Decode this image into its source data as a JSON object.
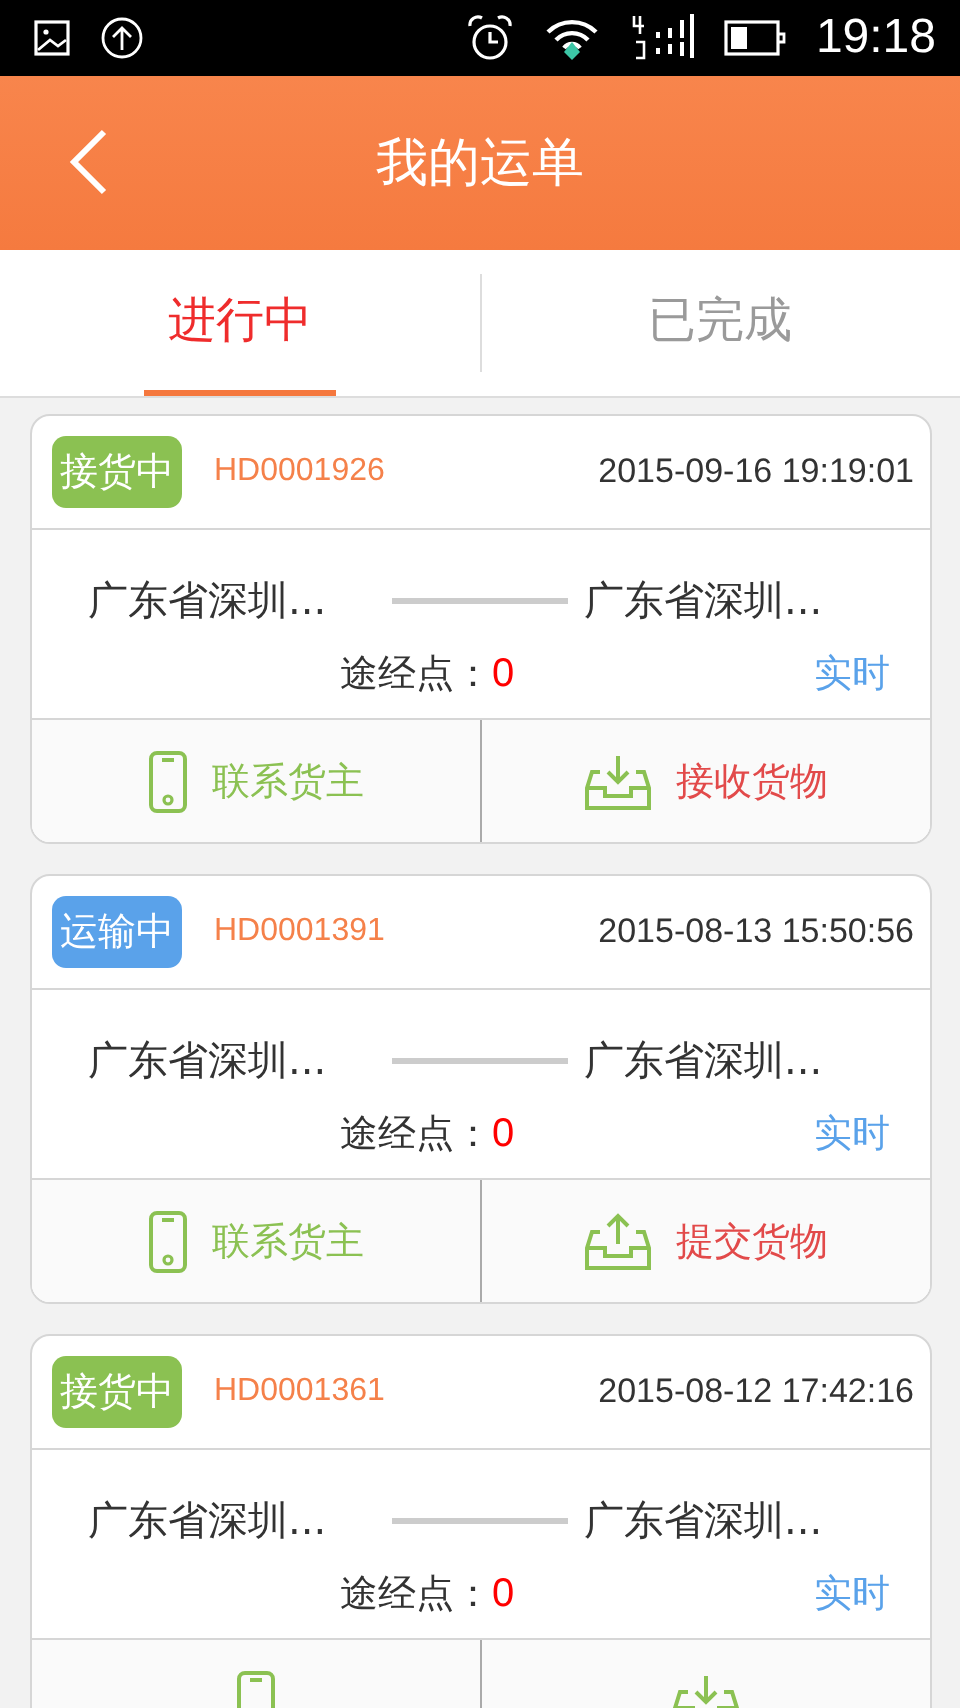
{
  "status_bar": {
    "time": "19:18"
  },
  "header": {
    "title": "我的运单"
  },
  "tabs": [
    {
      "label": "进行中",
      "selected": true
    },
    {
      "label": "已完成",
      "selected": false
    }
  ],
  "orders": [
    {
      "status": {
        "label": "接货中",
        "color": "#8bc152"
      },
      "order_no": "HD0001926",
      "datetime": "2015-09-16 19:19:01",
      "origin": "广东省深圳...",
      "destination": "广东省深圳...",
      "waypoints_label": "途经点：",
      "waypoints_count": "0",
      "realtime_link": "实时",
      "actions": [
        {
          "kind": "phone",
          "label": "联系货主"
        },
        {
          "kind": "receive",
          "label": "接收货物"
        }
      ]
    },
    {
      "status": {
        "label": "运输中",
        "color": "#5aa2ea"
      },
      "order_no": "HD0001391",
      "datetime": "2015-08-13 15:50:56",
      "origin": "广东省深圳...",
      "destination": "广东省深圳...",
      "waypoints_label": "途经点：",
      "waypoints_count": "0",
      "realtime_link": "实时",
      "actions": [
        {
          "kind": "phone",
          "label": "联系货主"
        },
        {
          "kind": "submit",
          "label": "提交货物"
        }
      ]
    },
    {
      "status": {
        "label": "接货中",
        "color": "#8bc152"
      },
      "order_no": "HD0001361",
      "datetime": "2015-08-12 17:42:16",
      "origin": "广东省深圳...",
      "destination": "广东省深圳...",
      "waypoints_label": "途经点：",
      "waypoints_count": "0",
      "realtime_link": "实时",
      "actions": [
        {
          "kind": "phone"
        },
        {
          "kind": "receive"
        }
      ]
    }
  ]
}
